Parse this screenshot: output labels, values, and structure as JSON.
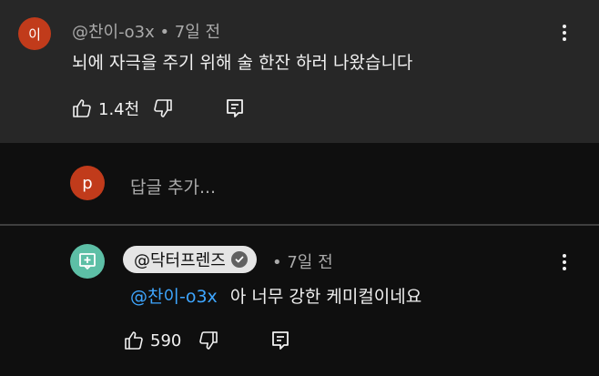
{
  "comment": {
    "avatar_letter": "이",
    "avatar_color": "#c13b1b",
    "author": "@찬이-o3x",
    "time": "• 7일 전",
    "text": "뇌에 자극을 주기 위해 술 한잔 하러 나왔습니다",
    "like_count": "1.4천"
  },
  "reply_box": {
    "avatar_letter": "p",
    "avatar_color": "#c13b1b",
    "placeholder": "답글 추가..."
  },
  "reply": {
    "avatar_color": "#5dbfa6",
    "author": "@닥터프렌즈",
    "time": "• 7일 전",
    "mention": "@찬이-o3x",
    "text": "아 너무 강한 케미컬이네요",
    "like_count": "590"
  },
  "icons": {
    "like": "thumb-up-icon",
    "dislike": "thumb-down-icon",
    "reply": "comment-reply-icon",
    "more": "more-vert-icon",
    "verified": "verified-check-icon"
  }
}
